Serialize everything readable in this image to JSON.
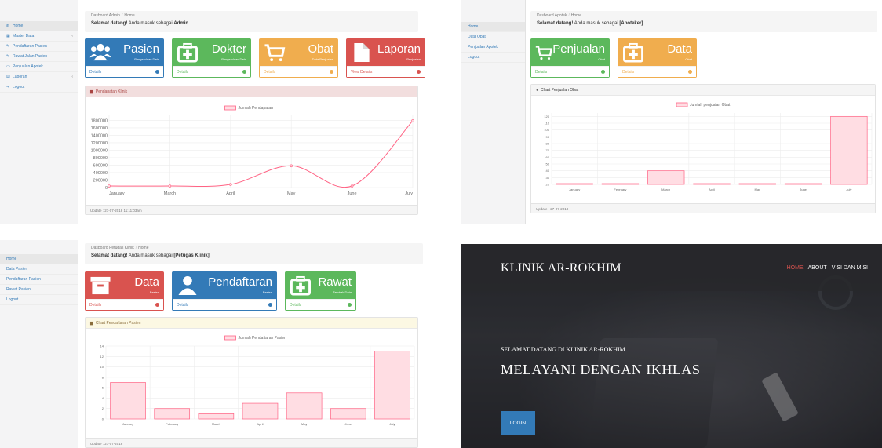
{
  "admin": {
    "sidebar": [
      {
        "label": "Home",
        "icon": "dashboard-icon",
        "caret": false
      },
      {
        "label": "Master Data",
        "icon": "grid-icon",
        "caret": true
      },
      {
        "label": "Pendaftaran Pasien",
        "icon": "edit-icon",
        "caret": false
      },
      {
        "label": "Rawat Jalan Pasien",
        "icon": "edit-icon",
        "caret": false
      },
      {
        "label": "Penjualan Apotek",
        "icon": "monitor-icon",
        "caret": false
      },
      {
        "label": "Laporan",
        "icon": "file-icon",
        "caret": true
      },
      {
        "label": "Logout",
        "icon": "logout-icon",
        "caret": false
      }
    ],
    "crumb_root": "Dasboard Admin",
    "crumb_current": "Home",
    "welcome_prefix": "Selamat datang!",
    "welcome_text": " Anda masuk sebagai ",
    "welcome_role": "Admin",
    "cards": [
      {
        "title": "Pasien",
        "sub": "Pengelolaan Data",
        "foot": "Details",
        "color": "#337ab7",
        "icon": "users-icon"
      },
      {
        "title": "Dokter",
        "sub": "Pengelolaan Data",
        "foot": "Details",
        "color": "#5cb85c",
        "icon": "medkit-icon"
      },
      {
        "title": "Obat",
        "sub": "Data Penjualan",
        "foot": "Details",
        "color": "#f0ad4e",
        "icon": "cart-icon"
      },
      {
        "title": "Laporan",
        "sub": "Penjualan",
        "foot": "View Details",
        "color": "#d9534f",
        "icon": "file-icon"
      }
    ],
    "chart_title": "Pendapatan Klinik",
    "chart_footer": "Update : 27-07-2018 11:11:03am"
  },
  "apoteker": {
    "sidebar": [
      "Home",
      "Data Obat",
      "Penjualan Apotek",
      "Logout"
    ],
    "crumb_root": "Dasboard Apotek",
    "crumb_current": "Home",
    "welcome_prefix": "Selamat datang!",
    "welcome_text": " Anda masuk sebagai ",
    "welcome_role": "[Apoteker]",
    "cards": [
      {
        "title": "Penjualan",
        "sub": "Obat",
        "foot": "Details",
        "color": "#5cb85c",
        "icon": "cart-icon"
      },
      {
        "title": "Data",
        "sub": "Obat",
        "foot": "Details",
        "color": "#f0ad4e",
        "icon": "medkit-icon"
      }
    ],
    "chart_title": "Chart Penjualan Obat",
    "chart_footer": "Update : 27-07-2018"
  },
  "petugas": {
    "sidebar": [
      "Home",
      "Data Pasien",
      "Pendaftaran Pasien",
      "Rawat Pasien",
      "Logout"
    ],
    "crumb_root": "Dasboard Petugas Klinik",
    "crumb_current": "Home",
    "welcome_prefix": "Selamat datang!",
    "welcome_text": " Anda masuk sebagai ",
    "welcome_role": "[Petugas Klinik]",
    "cards": [
      {
        "title": "Data",
        "sub": "Pasien",
        "foot": "Details",
        "color": "#d9534f",
        "icon": "archive-icon"
      },
      {
        "title": "Pendaftaran",
        "sub": "Pasien",
        "foot": "Details",
        "color": "#337ab7",
        "icon": "user-icon"
      },
      {
        "title": "Rawat",
        "sub": "Tambah Data",
        "foot": "Details",
        "color": "#5cb85c",
        "icon": "medkit-icon"
      }
    ],
    "chart_title": "Chart Pendaftaran Pasien",
    "chart_footer": "Update : 27-07-2018"
  },
  "landing": {
    "brand": "KLINIK AR-ROKHIM",
    "nav": [
      {
        "label": "HOME",
        "active": true
      },
      {
        "label": "ABOUT",
        "active": false
      },
      {
        "label": "VISI DAN MISI",
        "active": false
      }
    ],
    "subtitle": "SELAMAT DATANG DI KLINIK AR-ROKHIM",
    "title": "MELAYANI DENGAN IKHLAS",
    "login_label": "LOGIN"
  },
  "colors": {
    "line": "#ff6384",
    "bar_fill": "#ffdde3",
    "bar_stroke": "#ff6384"
  },
  "chart_data": [
    {
      "type": "line",
      "legend": "Jumlah Pendapatan",
      "categories": [
        "January",
        "March",
        "April",
        "May",
        "June",
        "July"
      ],
      "values": [
        50000,
        50000,
        100000,
        700000,
        50000,
        2150000
      ],
      "ytick_labels": [
        "0",
        "200000",
        "400000",
        "600000",
        "800000",
        "1000000",
        "1200000",
        "1400000",
        "1600000",
        "1800000"
      ],
      "ylim": [
        0,
        2350000
      ],
      "grid": true,
      "legend_position": "top"
    },
    {
      "type": "bar",
      "legend": "Jumlah penjualan Obat",
      "categories": [
        "January",
        "February",
        "March",
        "April",
        "May",
        "June",
        "July"
      ],
      "values": [
        20,
        20,
        40,
        20,
        20,
        20,
        120
      ],
      "ytick_labels": [
        "20",
        "30",
        "40",
        "50",
        "60",
        "70",
        "80",
        "90",
        "100",
        "110",
        "120"
      ],
      "ylim": [
        20,
        125
      ],
      "grid": true,
      "legend_position": "top"
    },
    {
      "type": "bar",
      "legend": "Jumlah Pendaftaran Pasien",
      "categories": [
        "January",
        "February",
        "March",
        "April",
        "May",
        "June",
        "July"
      ],
      "values": [
        7,
        2,
        1,
        3,
        5,
        2,
        13
      ],
      "ytick_labels": [
        "0",
        "2",
        "4",
        "6",
        "8",
        "10",
        "12",
        "14"
      ],
      "ylim": [
        0,
        14
      ],
      "grid": true,
      "legend_position": "top"
    }
  ]
}
